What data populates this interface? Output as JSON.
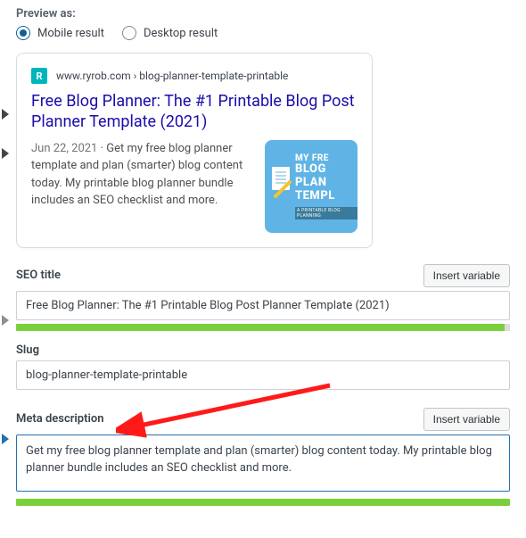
{
  "preview": {
    "label": "Preview as:",
    "options": {
      "mobile": "Mobile result",
      "desktop": "Desktop result"
    },
    "selected": "mobile",
    "breadcrumb": "www.ryrob.com › blog-planner-template-printable",
    "favicon_letter": "R",
    "title": "Free Blog Planner: The #1 Printable Blog Post Planner Template (2021)",
    "date": "Jun 22, 2021",
    "description": "Get my free blog planner template and plan (smarter) blog content today. My printable blog planner bundle includes an SEO checklist and more.",
    "thumb": {
      "line1": "MY FRE",
      "line2": "BLOG PLAN",
      "line3": "TEMPL",
      "sub": "A PRINTABLE BLOG PLANNING"
    }
  },
  "fields": {
    "seo_title": {
      "label": "SEO title",
      "value": "Free Blog Planner: The #1 Printable Blog Post Planner Template (2021)"
    },
    "slug": {
      "label": "Slug",
      "value": "blog-planner-template-printable"
    },
    "meta_description": {
      "label": "Meta description",
      "value": "Get my free blog planner template and plan (smarter) blog content today. My printable blog planner bundle includes an SEO checklist and more."
    },
    "insert_variable": "Insert variable"
  }
}
